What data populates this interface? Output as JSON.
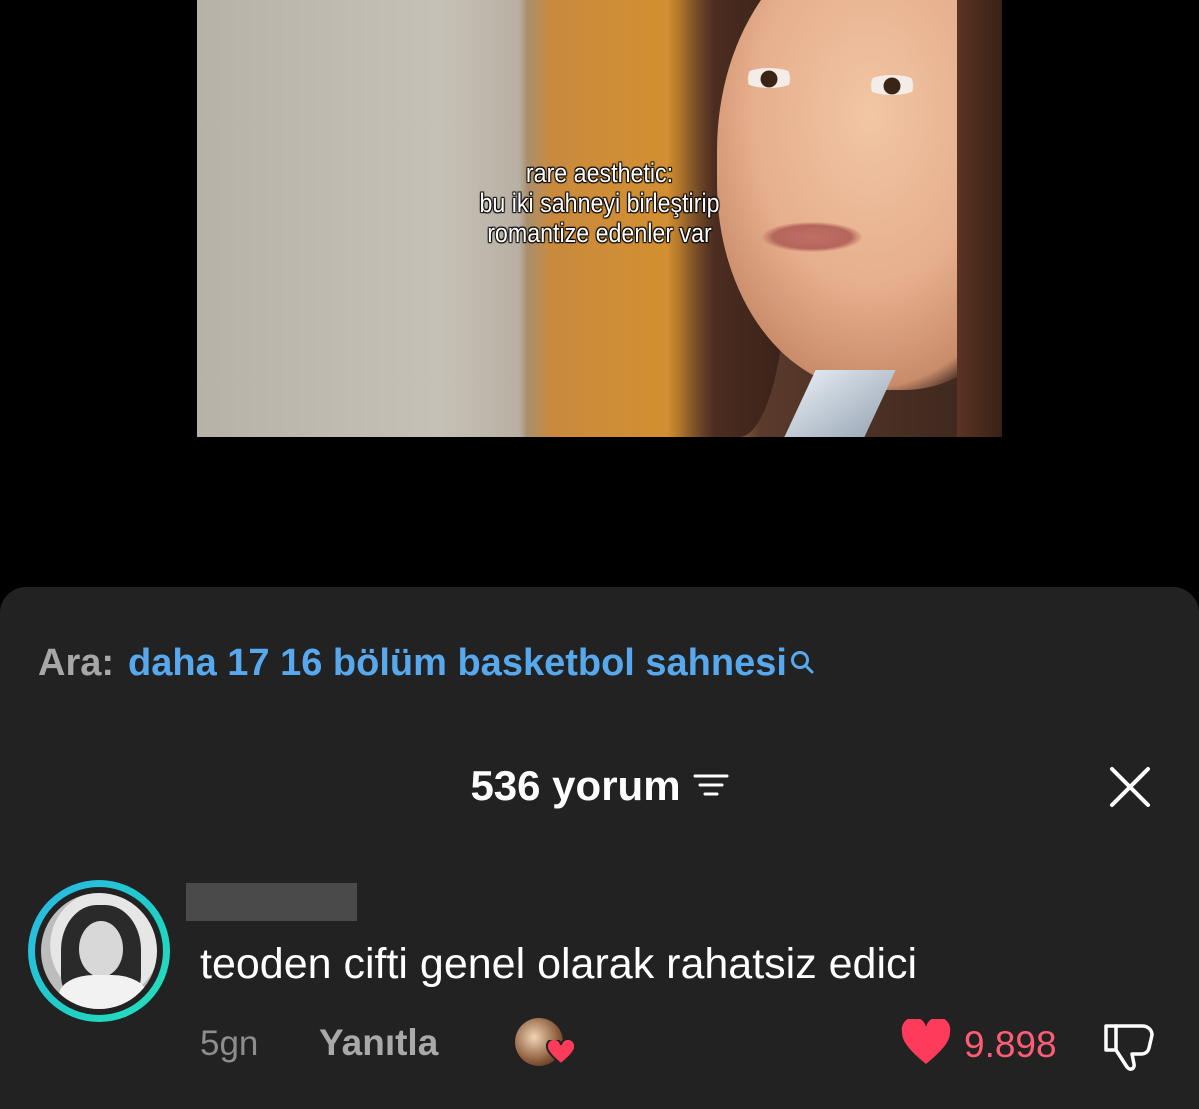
{
  "video": {
    "caption_lines": [
      "rare aesthetic:",
      "bu iki sahneyi birleştirip",
      "romantize edenler var"
    ]
  },
  "search": {
    "prefix": "Ara:",
    "query": "daha 17 16 bölüm basketbol sahnesi",
    "icon": "search-icon"
  },
  "comments_header": {
    "count_label": "536 yorum",
    "sort_icon": "sort-lines-icon",
    "close_icon": "close-icon"
  },
  "comment": {
    "text": "teoden cifti genel olarak rahatsiz edici",
    "time": "5gn",
    "reply_label": "Yanıtla",
    "like_count": "9.898",
    "liked": true,
    "liked_by_creator": true
  },
  "colors": {
    "accent_link": "#58a8ee",
    "like_red": "#ff3b5c",
    "sheet_bg": "#222222",
    "avatar_ring": "#28c8d8"
  }
}
